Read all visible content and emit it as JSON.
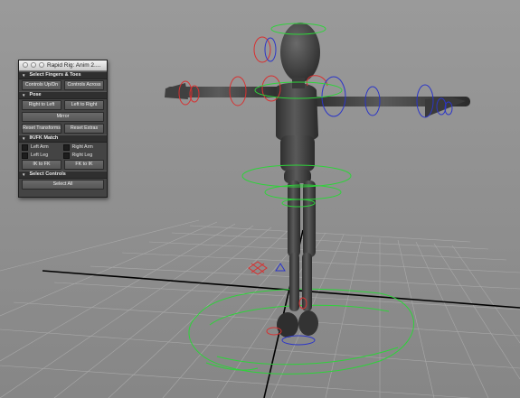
{
  "panel": {
    "title": "Rapid Rig: Anim 2....",
    "sections": {
      "fingers": "Select Fingers & Toes",
      "pose": "Pose",
      "ikfk": "IK/FK Match",
      "select": "Select Controls"
    },
    "buttons": {
      "controls_updn": "Controls Up/Dn",
      "controls_across": "Controls Across",
      "right_to_left": "Right to Left",
      "left_to_right": "Left to Right",
      "mirror": "Mirror",
      "reset_transforms": "Reset Transforms",
      "reset_extras": "Reset Extras",
      "ik_to_fk": "IK to FK",
      "fk_to_ik": "FK to IK",
      "select_all": "Select All"
    },
    "checkboxes": {
      "left_arm": "Left Arm",
      "right_arm": "Right Arm",
      "left_leg": "Left Leg",
      "right_leg": "Right Leg"
    }
  },
  "colors": {
    "viewport_bg": "#8d8d8d",
    "grid": "#a8a8a8",
    "axis": "#000000",
    "character": "#505050",
    "control_red": "#d83030",
    "control_blue": "#2b35c8",
    "control_green": "#2ed33a"
  }
}
